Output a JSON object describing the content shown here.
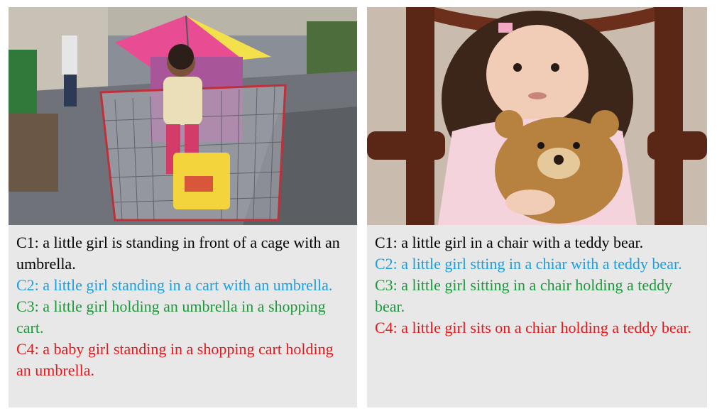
{
  "panels": [
    {
      "image_description_icon": "girl-in-shopping-cart-with-umbrella-photo",
      "captions": [
        {
          "text": "C1: a little girl is standing in front of a cage with an umbrella.",
          "color": "#000000"
        },
        {
          "text": "C2: a little girl standing in a cart with an umbrella.",
          "color": "#1a9fe0"
        },
        {
          "text": "C3: a little girl holding an umbrella in a shopping cart.",
          "color": "#1a9a3a"
        },
        {
          "text": "C4: a baby girl standing in a shopping cart holding an umbrella.",
          "color": "#e8171b"
        }
      ]
    },
    {
      "image_description_icon": "girl-in-chair-with-teddy-bear-photo",
      "captions": [
        {
          "text": "C1: a little girl in a chair with a teddy bear.",
          "color": "#000000"
        },
        {
          "text": "C2: a little girl stting in a chiar with a teddy bear.",
          "color": "#1a9fe0"
        },
        {
          "text": "C3: a little girl sitting in a chair holding a teddy bear.",
          "color": "#1a9a3a"
        },
        {
          "text": "C4: a little girl sits on a chiar holding a teddy bear.",
          "color": "#e8171b"
        }
      ]
    }
  ]
}
